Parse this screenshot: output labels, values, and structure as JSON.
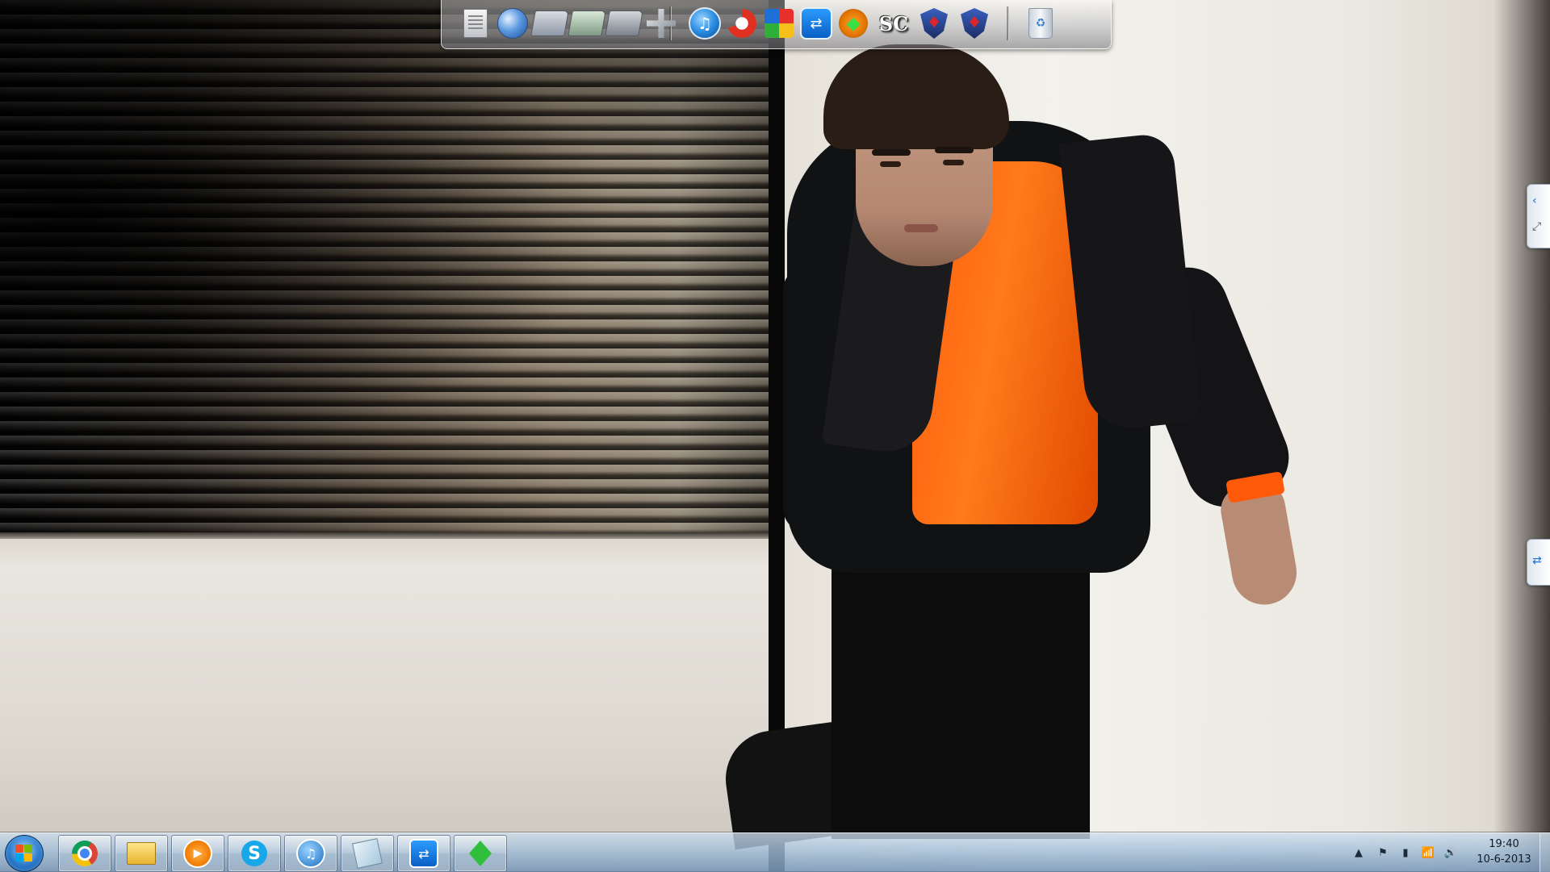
{
  "screen": {
    "os": "Windows 7"
  },
  "dock": {
    "items": [
      {
        "icon": "document-icon",
        "kind": "doc"
      },
      {
        "icon": "globe-network-icon",
        "kind": "globe"
      },
      {
        "icon": "folder-icon",
        "kind": "folder"
      },
      {
        "icon": "folder-pictures-icon",
        "kind": "folder-green"
      },
      {
        "icon": "folder-videos-icon",
        "kind": "folder-film"
      },
      {
        "icon": "tools-icon",
        "kind": "tool"
      },
      {
        "icon": "itunes-icon",
        "kind": "itunes",
        "glyph": "♫"
      },
      {
        "icon": "ccleaner-icon",
        "kind": "ccleaner"
      },
      {
        "icon": "avg-icon",
        "kind": "avg"
      },
      {
        "icon": "teamviewer-icon",
        "kind": "teamviewer",
        "glyph": "⇄"
      },
      {
        "icon": "sims-icon",
        "kind": "sims",
        "glyph": "◆"
      },
      {
        "icon": "sc-logo-icon",
        "kind": "sc",
        "glyph": "SC"
      },
      {
        "icon": "crest-icon",
        "kind": "crest"
      },
      {
        "icon": "crest-icon",
        "kind": "crest"
      },
      {
        "icon": "recycle-bin-icon",
        "kind": "bin",
        "glyph": "♻"
      }
    ]
  },
  "taskbar": {
    "pinned": [
      {
        "icon": "chrome-icon",
        "kind": "chrome"
      },
      {
        "icon": "windows-explorer-icon",
        "kind": "explorer"
      },
      {
        "icon": "windows-media-player-icon",
        "kind": "wmp",
        "glyph": "▶"
      },
      {
        "icon": "skype-icon",
        "kind": "skype",
        "glyph": "S"
      },
      {
        "icon": "itunes-icon",
        "kind": "itunes",
        "glyph": "♫"
      },
      {
        "icon": "sticky-notes-icon",
        "kind": "notes"
      },
      {
        "icon": "teamviewer-icon",
        "kind": "teamviewer",
        "glyph": "⇄"
      },
      {
        "icon": "sims-icon",
        "kind": "sims"
      }
    ],
    "tray": {
      "icons": [
        {
          "name": "show-hidden-icons-icon",
          "glyph": "▲"
        },
        {
          "name": "action-center-flag-icon",
          "glyph": "⚑"
        },
        {
          "name": "power-icon",
          "glyph": "▮"
        },
        {
          "name": "network-signal-icon",
          "glyph": "📶"
        },
        {
          "name": "volume-icon",
          "glyph": "🔊"
        }
      ],
      "time": "19:40",
      "date": "10-6-2013"
    }
  },
  "side_tabs": [
    {
      "name": "side-collapse-tab",
      "glyphs": [
        "‹",
        "⤢"
      ]
    },
    {
      "name": "teamviewer-side-tab",
      "glyphs": [
        "⇄"
      ]
    }
  ],
  "colors": {
    "taskbar": "#a9c2da",
    "accent_orange": "#ff5b0c"
  }
}
